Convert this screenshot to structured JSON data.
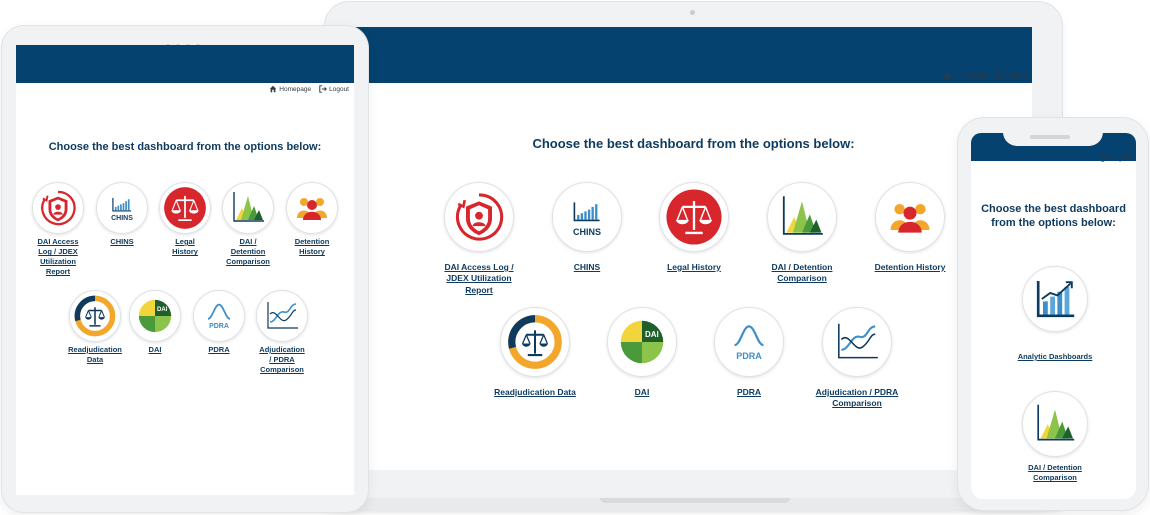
{
  "nav": {
    "homepage": "Homepage",
    "logout": "Logout"
  },
  "heading": "Choose the best dashboard from the options below:",
  "phone_heading": {
    "line1": "Choose the best dashboard",
    "line2": "from the options below:"
  },
  "dashboards": {
    "dai_access_log": "DAI Access Log / JDEX Utilization Report",
    "chins": "CHINS",
    "legal_history": "Legal History",
    "dai_detention": "DAI / Detention Comparison",
    "detention_history": "Detention History",
    "readjudication": "Readjudication Data",
    "dai": "DAI",
    "pdra": "PDRA",
    "adjudication_pdra": "Adjudication / PDRA Comparison",
    "analytic": "Analytic Dashboards"
  },
  "tablet_labels": {
    "dai_access_log": [
      "DAI Access",
      "Log / JDEX",
      "Utilization",
      "Report"
    ],
    "legal_history": [
      "Legal",
      "History"
    ],
    "dai_detention": [
      "DAI /",
      "Detention",
      "Comparison"
    ],
    "detention_history": [
      "Detention",
      "History"
    ],
    "readjudication": [
      "Readjudication",
      "Data"
    ],
    "adjudication_pdra": [
      "Adjudication",
      "/ PDRA",
      "Comparison"
    ]
  },
  "laptop_labels": {
    "dai_access_log": [
      "DAI Access Log /",
      "JDEX Utilization",
      "Report"
    ],
    "dai_detention": [
      "DAI / Detention",
      "Comparison"
    ],
    "adjudication_pdra": [
      "Adjudication / PDRA",
      "Comparison"
    ]
  },
  "phone_labels": {
    "dai_detention": [
      "DAI / Detention",
      "Comparison"
    ]
  },
  "icon_text": {
    "chins": "CHINS",
    "dai": "DAI",
    "pdra": "PDRA"
  },
  "colors": {
    "header": "#06426f",
    "title": "#0d3a5e",
    "red": "#d7262c",
    "green": "#4a9a3c",
    "blue": "#3b8fcb",
    "yellow": "#f2a72b"
  }
}
